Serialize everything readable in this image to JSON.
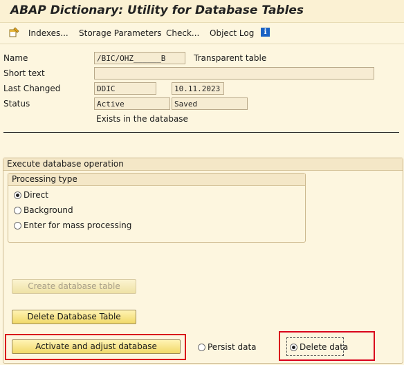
{
  "title": "ABAP Dictionary: Utility for Database Tables",
  "toolbar": {
    "icon": "table-edit-icon",
    "items": [
      "Indexes...",
      "Storage Parameters",
      "Check...",
      "Object Log"
    ],
    "info_icon": "i"
  },
  "fields": {
    "name_label": "Name",
    "name_value": "/BIC/OHZ______B",
    "table_type": "Transparent table",
    "short_text_label": "Short text",
    "short_text_value": "",
    "last_changed_label": "Last Changed",
    "last_changed_user": "DDIC",
    "last_changed_date": "10.11.2023",
    "status_label": "Status",
    "status_value": "Active",
    "status_saved": "Saved",
    "status_note": "Exists in the database"
  },
  "execute_group": {
    "title": "Execute database operation",
    "processing_type": {
      "title": "Processing type",
      "options": [
        "Direct",
        "Background",
        "Enter for mass processing"
      ],
      "selected": "Direct"
    },
    "buttons": {
      "create": "Create database table",
      "delete": "Delete Database Table",
      "activate": "Activate and adjust database"
    },
    "data_options": {
      "persist": "Persist data",
      "delete": "Delete data",
      "selected": "Delete data"
    }
  },
  "colors": {
    "highlight": "#d9001b",
    "button": "#f1d968",
    "background": "#fdf6df"
  }
}
